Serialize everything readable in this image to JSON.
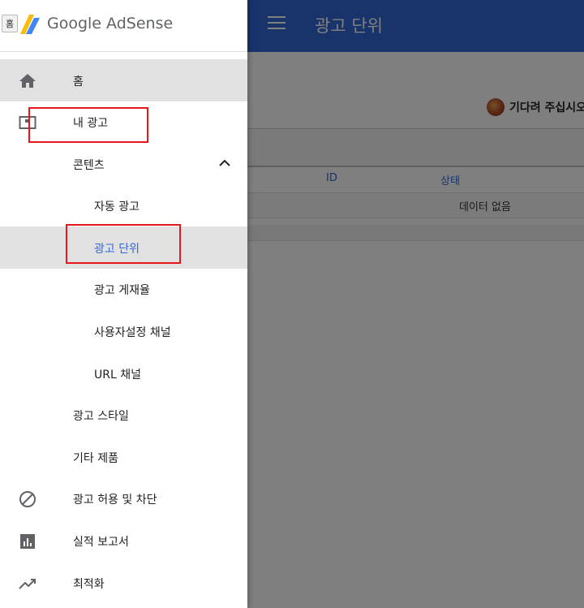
{
  "header": {
    "page_title": "광고 단위"
  },
  "main": {
    "loading_text": "기다려 주십시오.",
    "table": {
      "columns": [
        "ID",
        "상태"
      ],
      "empty_text": "데이터 없음"
    }
  },
  "drawer": {
    "home_chip": "홈",
    "brand": "Google AdSense",
    "items": [
      {
        "label": "홈",
        "icon": "home-icon"
      },
      {
        "label": "내 광고",
        "icon": "ad-units-icon"
      },
      {
        "label": "콘텐츠",
        "icon": "chevron-up-icon"
      },
      {
        "label": "자동 광고"
      },
      {
        "label": "광고 단위"
      },
      {
        "label": "광고 게재율"
      },
      {
        "label": "사용자설정 채널"
      },
      {
        "label": "URL 채널"
      },
      {
        "label": "광고 스타일"
      },
      {
        "label": "기타 제품"
      },
      {
        "label": "광고 허용 및 차단",
        "icon": "block-icon"
      },
      {
        "label": "실적 보고서",
        "icon": "bar-chart-icon"
      },
      {
        "label": "최적화",
        "icon": "trending-up-icon"
      }
    ]
  },
  "colors": {
    "header_bg": "#3367d6",
    "selected_text": "#3367d6",
    "highlight_box": "#e8161c",
    "active_row_bg": "#e1e1e1"
  }
}
